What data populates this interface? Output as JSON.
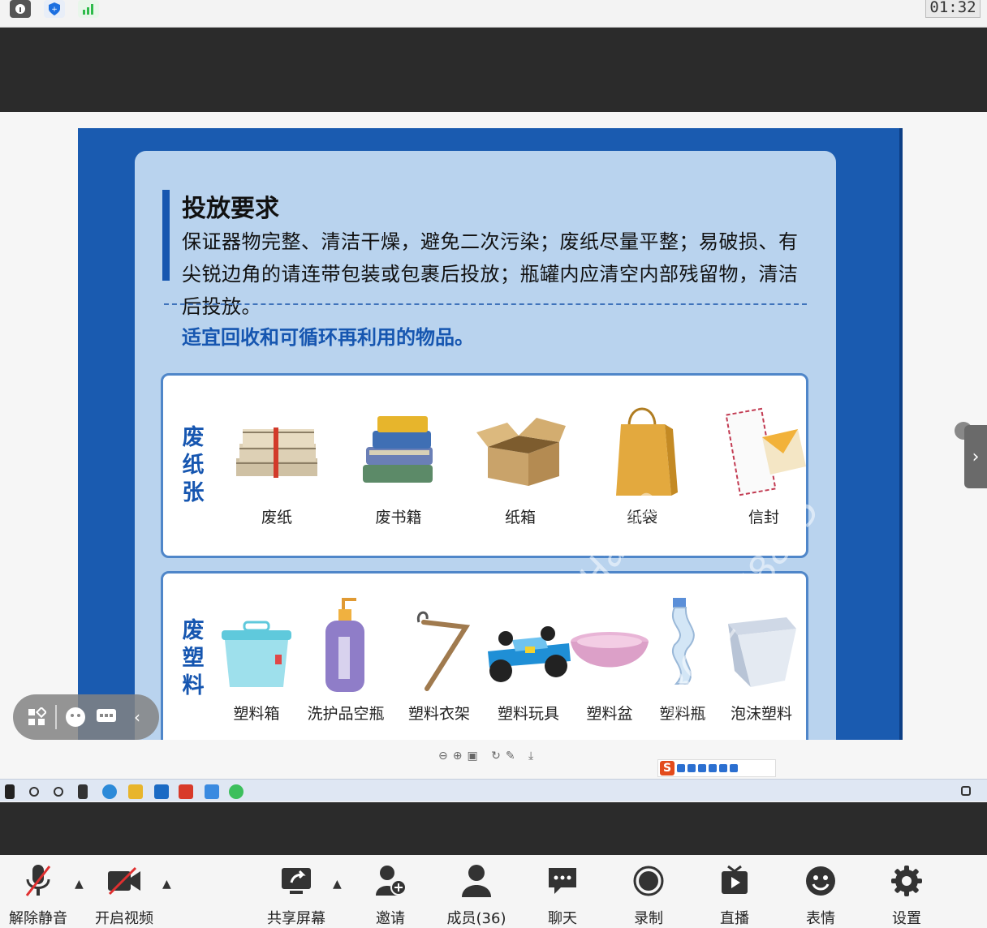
{
  "clock": "01:32",
  "slide": {
    "title": "投放要求",
    "body": "保证器物完整、清洁干燥，避免二次污染；废纸尽量平整；易破损、有尖锐边角的请连带包装或包裹后投放；瓶罐内应清空内部残留物，清洁后投放。",
    "subtitle": "适宜回收和可循环再利用的物品。",
    "watermark_1": "Haree",
    "watermark_2": "+8618021658835",
    "categories": [
      {
        "label": "废纸张",
        "items": [
          {
            "label": "废纸",
            "icon": "newspaper-stack-icon"
          },
          {
            "label": "废书籍",
            "icon": "book-stack-icon"
          },
          {
            "label": "纸箱",
            "icon": "cardboard-box-icon"
          },
          {
            "label": "纸袋",
            "icon": "paper-bag-icon"
          },
          {
            "label": "信封",
            "icon": "envelope-icon"
          }
        ]
      },
      {
        "label": "废塑料",
        "items": [
          {
            "label": "塑料箱",
            "icon": "plastic-box-icon"
          },
          {
            "label": "洗护品空瓶",
            "icon": "lotion-bottle-icon"
          },
          {
            "label": "塑料衣架",
            "icon": "hanger-icon"
          },
          {
            "label": "塑料玩具",
            "icon": "toy-car-icon"
          },
          {
            "label": "塑料盆",
            "icon": "basin-icon"
          },
          {
            "label": "塑料瓶",
            "icon": "plastic-bottle-icon"
          },
          {
            "label": "泡沫塑料",
            "icon": "foam-box-icon"
          }
        ]
      }
    ]
  },
  "toolbar": {
    "items": [
      {
        "label": "解除静音",
        "icon": "microphone-muted-icon"
      },
      {
        "label": "开启视频",
        "icon": "camera-off-icon"
      },
      {
        "label": "共享屏幕",
        "icon": "share-screen-icon"
      },
      {
        "label": "邀请",
        "icon": "invite-icon"
      },
      {
        "label": "成员(36)",
        "icon": "members-icon"
      },
      {
        "label": "聊天",
        "icon": "chat-icon"
      },
      {
        "label": "录制",
        "icon": "record-icon"
      },
      {
        "label": "直播",
        "icon": "live-icon"
      },
      {
        "label": "表情",
        "icon": "emoji-icon"
      },
      {
        "label": "设置",
        "icon": "settings-icon"
      }
    ]
  },
  "colors": {
    "slide_blue": "#1a5bb0",
    "panel_blue": "#b9d3ee",
    "accent": "#1656b0"
  }
}
